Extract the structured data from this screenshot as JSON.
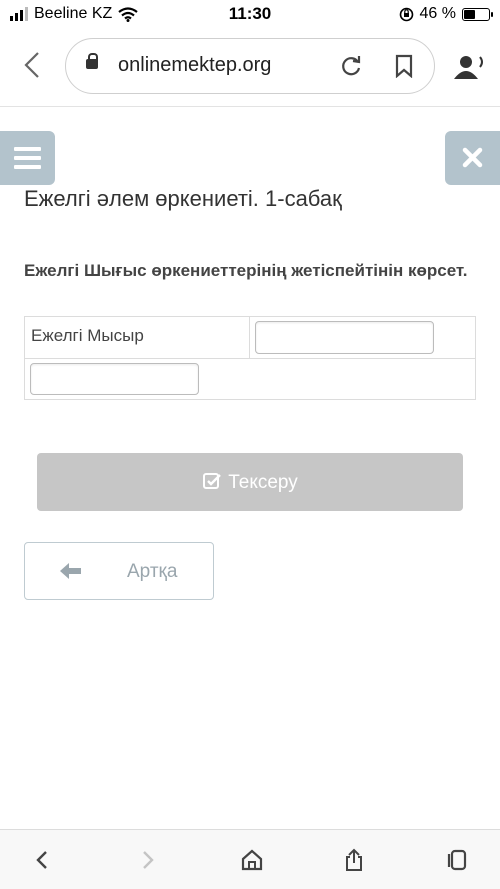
{
  "status_bar": {
    "carrier": "Beeline KZ",
    "time": "11:30",
    "battery": "46 %",
    "battery_level": 0.46
  },
  "browser": {
    "url": "onlinemektep.org",
    "icons": {
      "back": "chevron-left-icon",
      "lock": "lock-icon",
      "reload": "reload-icon",
      "bookmark": "bookmark-icon",
      "listen": "listen-icon"
    }
  },
  "page": {
    "title": "Ежелгі әлем өркениеті. 1-сабақ",
    "question": "Ежелгі Шығыс өркениеттерінің жетіспейтінін көрсет.",
    "table": {
      "row1_label": "Ежелгі Мысыр",
      "row1_input_value": "",
      "row2_input_value": ""
    },
    "check_button": "Тексеру",
    "back_button": "Артқа"
  },
  "colors": {
    "side_buttons": "#b3c3cc",
    "check_button_bg": "#c6c6c6",
    "back_button_text": "#9aa6ad"
  }
}
